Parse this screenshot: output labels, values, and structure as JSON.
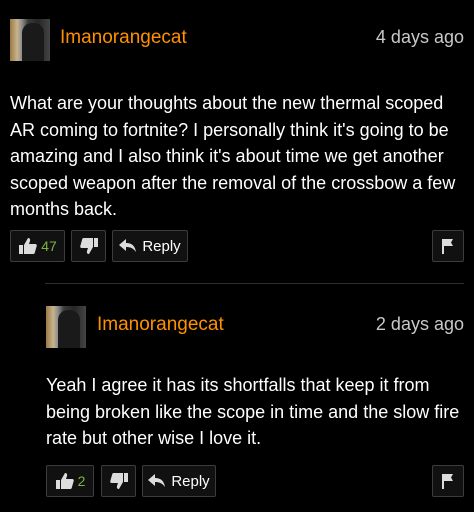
{
  "comments": [
    {
      "username": "Imanorangecat",
      "time": "4 days ago",
      "text": "What are your thoughts about the new thermal scoped AR coming to fortnite? I personally think it's going to be amazing and I also think it's about time we get another scoped weapon after the removal of the crossbow a few months back.",
      "likes": "47",
      "reply_label": "Reply"
    },
    {
      "username": "Imanorangecat",
      "time": "2 days ago",
      "text": "Yeah I agree it has its shortfalls that keep it from being broken like the scope in time and the slow fire rate but other wise I love it.",
      "likes": "2",
      "reply_label": "Reply"
    }
  ],
  "colors": {
    "username": "#ff9000",
    "likes": "#7cb342",
    "background": "#000000"
  },
  "icons": [
    "thumbs-up-icon",
    "thumbs-down-icon",
    "reply-arrow-icon",
    "flag-icon"
  ]
}
